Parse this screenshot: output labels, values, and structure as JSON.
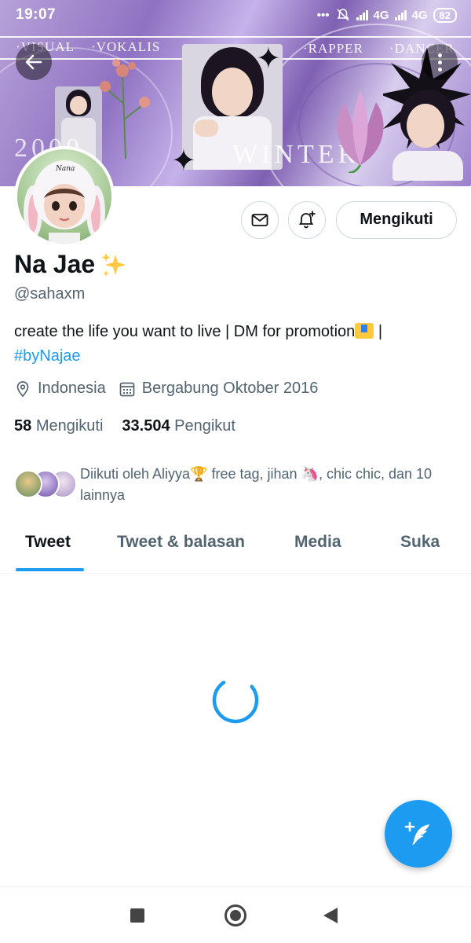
{
  "status_bar": {
    "time": "19:07",
    "network_1": "4G",
    "network_2": "4G",
    "battery": "82"
  },
  "banner": {
    "texts": [
      "·VISUAL",
      "·VOKALIS",
      "·RAPPER",
      "·DANCER"
    ],
    "caption": "WINTER",
    "year": "2000"
  },
  "profile": {
    "display_name": "Na Jae",
    "handle": "@sahaxm",
    "bio_text": "create the life you want to live | DM for promotion",
    "bio_sep": " |",
    "bio_hashtag": "#byNajae",
    "location": "Indonesia",
    "joined": "Bergabung Oktober 2016",
    "following_count": "58",
    "following_label": "Mengikuti",
    "followers_count": "33.504",
    "followers_label": "Pengikut",
    "followed_by": "Diikuti oleh Aliyya🏆 free tag, jihan 🦄, chic chic, dan 10 lainnya",
    "avatar_caption": "Nana"
  },
  "actions": {
    "follow_label": "Mengikuti"
  },
  "tabs": [
    {
      "label": "Tweet"
    },
    {
      "label": "Tweet & balasan"
    },
    {
      "label": "Media"
    },
    {
      "label": "Suka"
    }
  ],
  "colors": {
    "accent": "#1d9bf0",
    "text_primary": "#0f1419",
    "text_secondary": "#536471"
  },
  "icons": {
    "back": "arrow-left-icon",
    "more": "more-vertical-icon",
    "message": "mail-icon",
    "notify": "bell-plus-icon",
    "location": "location-pin-icon",
    "calendar": "calendar-icon",
    "compose": "compose-tweet-icon",
    "spinner": "loading-spinner-icon"
  }
}
